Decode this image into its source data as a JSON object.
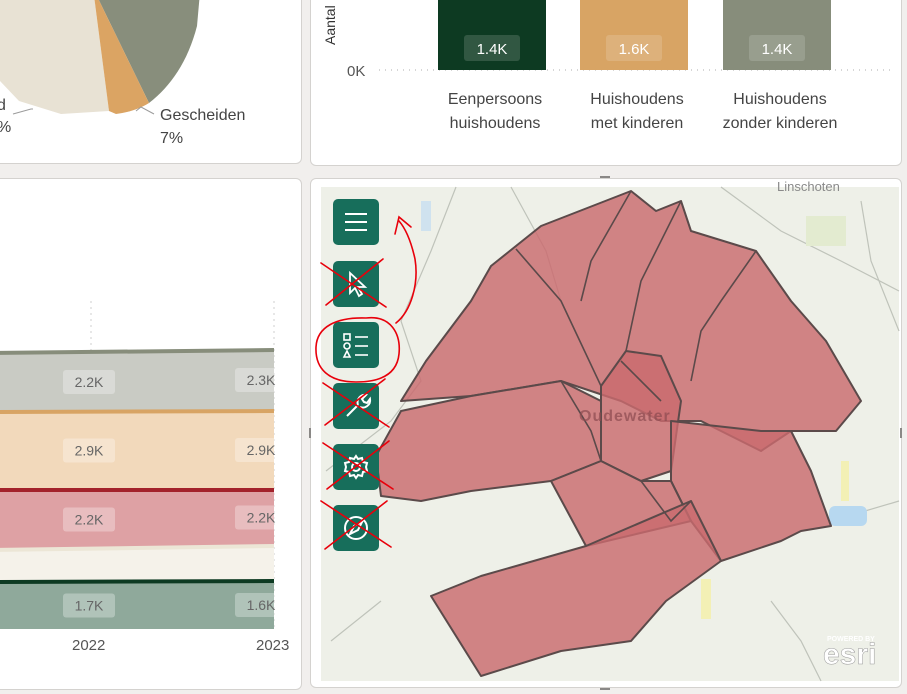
{
  "colors": {
    "pie_grey": "#888e7c",
    "pie_cream": "#e8e2d4",
    "pie_orange": "#dba463",
    "pie_dark": "#0d3a22",
    "bar_dark": "#0d3a22",
    "bar_orange": "#d8a464",
    "bar_grey": "#878d7b",
    "area_grey": "#c9cbc4",
    "area_orange": "#f2d9bb",
    "area_red": "#dea1a4",
    "area_cream": "#f5f2ea",
    "area_green": "#8fa99b",
    "map_polygon": "#c96a6e",
    "map_bg": "#eef0e8",
    "toolbar_button": "#176e5b",
    "annotation_red": "#e8000b"
  },
  "pie_chart": {
    "labels": [
      {
        "name": "Gescheiden",
        "percent": "7%"
      },
      {
        "name": "d",
        "percent": "%"
      }
    ]
  },
  "bar_chart": {
    "ylabel": "Aantal",
    "tick_zero": "0K"
  },
  "area_chart": {
    "x_labels": [
      "2022",
      "2023"
    ]
  },
  "chart_data": [
    {
      "type": "bar",
      "ylabel": "Aantal",
      "categories": [
        [
          "Eenpersoons",
          "huishoudens"
        ],
        [
          "Huishoudens",
          "met kinderen"
        ],
        [
          "Huishoudens",
          "zonder kinderen"
        ]
      ],
      "values": [
        1400,
        1600,
        1400
      ],
      "value_labels": [
        "1.4K",
        "1.6K",
        "1.4K"
      ],
      "colors": [
        "#0d3a22",
        "#d8a464",
        "#878d7b"
      ],
      "y_tick_labels": [
        "0K"
      ]
    },
    {
      "type": "area",
      "x": [
        "2022",
        "2023"
      ],
      "series": [
        {
          "values": [
            2200,
            2300
          ],
          "labels": [
            "2.2K",
            "2.3K"
          ],
          "fill": "#c9cbc4",
          "line": "#878d7b"
        },
        {
          "values": [
            2900,
            2900
          ],
          "labels": [
            "2.9K",
            "2.9K"
          ],
          "fill": "#f2d9bb",
          "line": "#d8a464"
        },
        {
          "values": [
            2200,
            2200
          ],
          "labels": [
            "2.2K",
            "2.2K"
          ],
          "fill": "#dea1a4",
          "line": "#a3222b"
        },
        {
          "values": [
            null,
            null
          ],
          "labels": [
            "",
            ""
          ],
          "fill": "#f5f2ea",
          "line": "#ece6d6"
        },
        {
          "values": [
            1700,
            1600
          ],
          "labels": [
            "1.7K",
            "1.6K"
          ],
          "fill": "#8fa99b",
          "line": "#0d3a22"
        }
      ]
    }
  ],
  "map": {
    "place_label": "Oudewater",
    "town_label": "Linschoten",
    "attribution_top": "POWERED BY",
    "attribution_logo": "esri"
  },
  "map_toolbar": {
    "buttons": [
      {
        "name": "menu",
        "icon": "hamburger-icon",
        "crossed_out": false
      },
      {
        "name": "select",
        "icon": "cursor-icon",
        "crossed_out": true
      },
      {
        "name": "legend",
        "icon": "legend-list-icon",
        "crossed_out": false,
        "circled": true
      },
      {
        "name": "tools",
        "icon": "wrench-icon",
        "crossed_out": true
      },
      {
        "name": "settings",
        "icon": "gear-icon",
        "crossed_out": true
      },
      {
        "name": "locate",
        "icon": "compass-icon",
        "crossed_out": true
      }
    ]
  }
}
